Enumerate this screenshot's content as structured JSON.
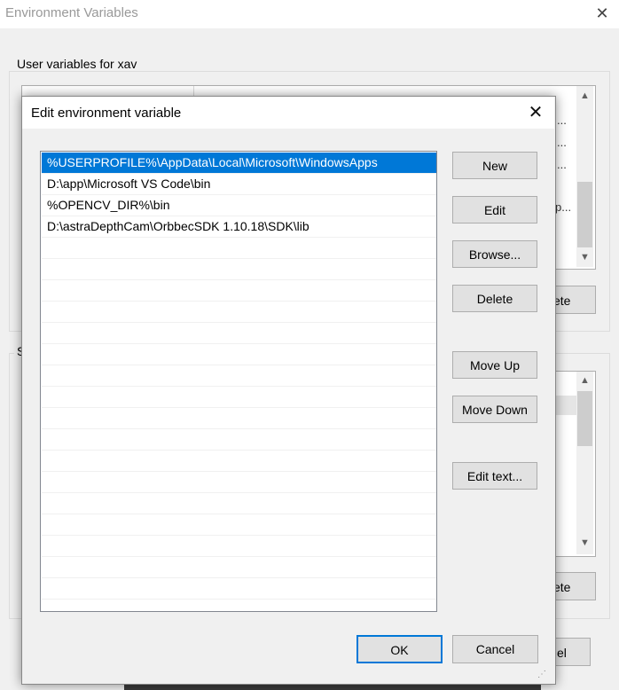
{
  "background_window": {
    "title": "Environment Variables",
    "user_group_label": "User variables for xav",
    "user_list_ellipses": [
      "...",
      "...",
      "...",
      "p..."
    ],
    "user_partial_button_text": "ete",
    "system_group_label_partial": "S",
    "system_partial_button_text": "ete",
    "cancel_partial_text": "el"
  },
  "dialog": {
    "title": "Edit environment variable",
    "paths": [
      "%USERPROFILE%\\AppData\\Local\\Microsoft\\WindowsApps",
      "D:\\app\\Microsoft VS Code\\bin",
      "%OPENCV_DIR%\\bin",
      "D:\\astraDepthCam\\OrbbecSDK 1.10.18\\SDK\\lib",
      "",
      "",
      "",
      "",
      "",
      "",
      "",
      "",
      "",
      "",
      "",
      "",
      "",
      "",
      "",
      "",
      "",
      ""
    ],
    "selected_index": 0,
    "buttons": {
      "new": "New",
      "edit": "Edit",
      "browse": "Browse...",
      "delete": "Delete",
      "move_up": "Move Up",
      "move_down": "Move Down",
      "edit_text": "Edit text...",
      "ok": "OK",
      "cancel": "Cancel"
    }
  },
  "icons": {
    "close": "close-icon",
    "scroll_up": "chevron-up-icon",
    "scroll_down": "chevron-down-icon",
    "resize_grip": "resize-grip-icon"
  },
  "colors": {
    "accent": "#0078d7",
    "window_bg": "#f0f0f0",
    "button_bg": "#e1e1e1"
  }
}
